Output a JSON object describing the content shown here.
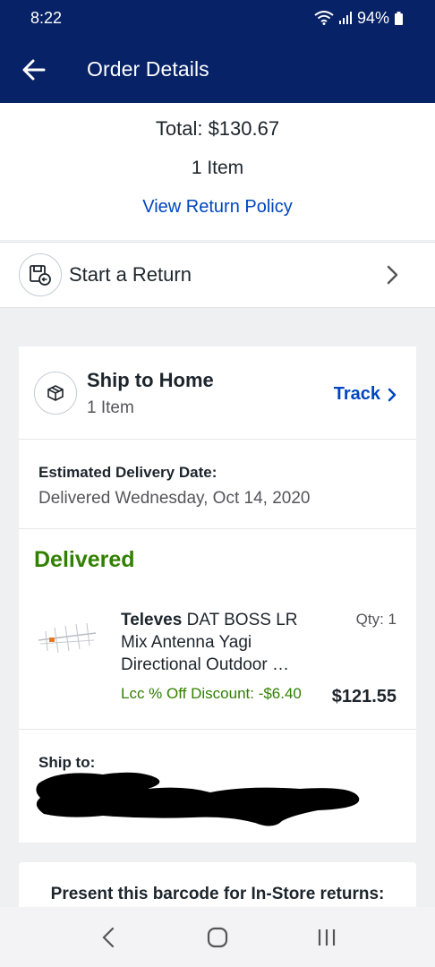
{
  "status_bar": {
    "time": "8:22",
    "battery": "94%"
  },
  "app_bar": {
    "title": "Order Details"
  },
  "summary": {
    "total": "Total: $130.67",
    "item_count": "1 Item",
    "return_policy_link": "View Return Policy"
  },
  "start_return": {
    "label": "Start a Return"
  },
  "shipment": {
    "title": "Ship to Home",
    "item_count": "1 Item",
    "track_label": "Track",
    "delivery_label": "Estimated Delivery Date:",
    "delivery_value": "Delivered Wednesday, Oct 14, 2020",
    "status": "Delivered",
    "product": {
      "brand": "Televes",
      "name_rest": " DAT BOSS LR Mix Antenna Yagi Directional Outdoor …",
      "qty": "Qty: 1",
      "discount": "Lcc % Off Discount: -$6.40",
      "price": "$121.55"
    },
    "ship_to_label": "Ship to:"
  },
  "barcode": {
    "label": "Present this barcode for In-Store returns:"
  },
  "colors": {
    "header_bg": "#072266",
    "link_blue": "#0046be",
    "green": "#318000"
  },
  "icons": [
    "back-arrow-icon",
    "wifi-icon",
    "signal-icon",
    "battery-icon",
    "return-box-icon",
    "chevron-right-icon",
    "package-icon",
    "nav-back-icon",
    "nav-home-icon",
    "nav-recents-icon"
  ]
}
